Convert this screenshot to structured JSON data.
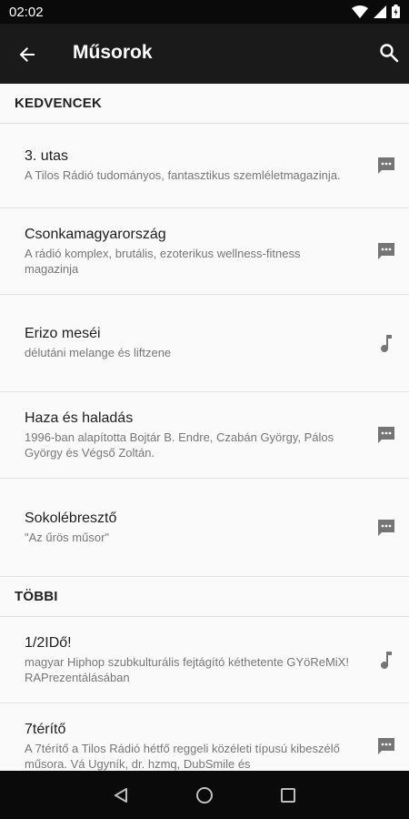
{
  "status_bar": {
    "time": "02:02"
  },
  "app_bar": {
    "title": "Műsorok"
  },
  "sections": [
    {
      "header": "KEDVENCEK",
      "items": [
        {
          "name": "3. utas",
          "desc": "A Tilos Rádió tudományos, fantasztikus szemléletmagazinja.",
          "icon": "chat-icon"
        },
        {
          "name": "Csonkamagyarország",
          "desc": "A rádió komplex, brutális, ezoterikus wellness-fitness magazinja",
          "icon": "chat-icon"
        },
        {
          "name": "Erizo meséi",
          "desc": "délutáni melange és liftzene",
          "icon": "music-note-icon"
        },
        {
          "name": "Haza és haladás",
          "desc": "1996-ban alapította Bojtár B. Endre, Czabán György, Pálos György és Végső Zoltán.",
          "icon": "chat-icon"
        },
        {
          "name": "Sokolébresztő",
          "desc": "\"Az űrös műsor\"",
          "icon": "chat-icon"
        }
      ]
    },
    {
      "header": "TÖBBI",
      "items": [
        {
          "name": "1/2IDő!",
          "desc": "magyar Hiphop szubkulturális fejtágító kéthetente GYöReMiX! RAPrezentálásában",
          "icon": "music-note-icon"
        },
        {
          "name": "7térítő",
          "desc": "A 7térítő a Tilos Rádió hétfő reggeli közéleti típusú kibeszélő műsora. Vá Ugyník, dr. hzmq, DubSmile és",
          "icon": "chat-icon"
        }
      ]
    }
  ]
}
